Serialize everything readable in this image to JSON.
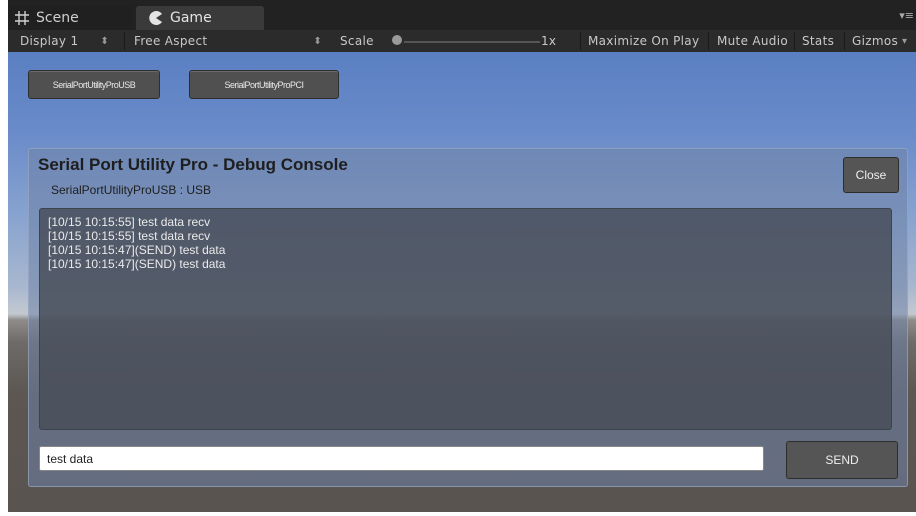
{
  "tabs": [
    {
      "label": "Scene",
      "icon": "grid-icon"
    },
    {
      "label": "Game",
      "icon": "pacman-icon"
    }
  ],
  "tab_menu": "▾≡",
  "toolbar": {
    "display": "Display 1",
    "aspect": "Free Aspect",
    "scale_label": "Scale",
    "scale_value": "1x",
    "maximize": "Maximize On Play",
    "mute": "Mute Audio",
    "stats": "Stats",
    "gizmos": "Gizmos"
  },
  "game": {
    "buttons": [
      "SerialPortUtilityProUSB",
      "SerialPortUtilityProPCI"
    ],
    "console": {
      "title": "Serial Port Utility Pro - Debug Console",
      "subtitle": "SerialPortUtilityProUSB : USB",
      "close_label": "Close",
      "log": [
        "[10/15 10:15:55] test data recv",
        "[10/15 10:15:55] test data recv",
        "[10/15 10:15:47](SEND) test data",
        "[10/15 10:15:47](SEND) test data"
      ],
      "input_value": "test data",
      "send_label": "SEND"
    }
  },
  "colors": {
    "toolbar_bg": "#2b2b2b",
    "tabbar_bg": "#222222",
    "sky_top": "#5a7fc2",
    "ground": "#5a5450"
  }
}
